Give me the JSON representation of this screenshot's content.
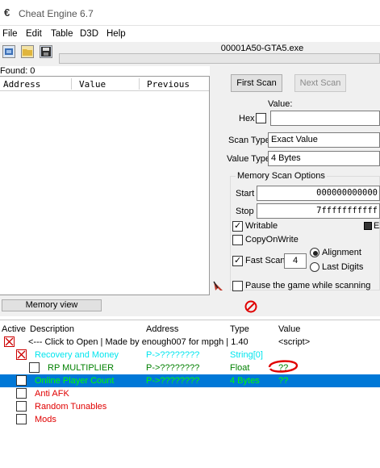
{
  "window": {
    "title": "Cheat Engine 6.7"
  },
  "menu": [
    "File",
    "Edit",
    "Table",
    "D3D",
    "Help"
  ],
  "process": "00001A50-GTA5.exe",
  "found": "Found: 0",
  "results_columns": [
    "Address",
    "Value",
    "Previous"
  ],
  "scan": {
    "first_scan": "First Scan",
    "next_scan": "Next Scan",
    "value_label": "Value:",
    "hex_label": "Hex",
    "scan_type_label": "Scan Type",
    "scan_type_value": "Exact Value",
    "value_type_label": "Value Type",
    "value_type_value": "4 Bytes",
    "memory_options_title": "Memory Scan Options",
    "start_label": "Start",
    "start_value": "000000000000",
    "stop_label": "Stop",
    "stop_value": "7fffffffffff",
    "writable_label": "Writable",
    "exe_label": "Exe",
    "copyonwrite_label": "CopyOnWrite",
    "fastscan_label": "Fast Scan",
    "fastscan_value": "4",
    "alignment_label": "Alignment",
    "lastdigits_label": "Last Digits",
    "pause_label": "Pause the game while scanning"
  },
  "memory_view_button": "Memory view",
  "table_columns": {
    "active": "Active",
    "description": "Description",
    "address": "Address",
    "type": "Type",
    "value": "Value"
  },
  "rows": [
    {
      "description": "<--- Click to Open  | Made by enough007 for mpgh | 1.40",
      "address": "",
      "type": "",
      "value": "<script>",
      "color": "#000000",
      "checked": true,
      "red_check": true
    },
    {
      "description": "Recovery and Money",
      "address": "P->????????",
      "type": "String[0]",
      "value": "",
      "color": "#00e5ee",
      "checked": false
    },
    {
      "description": "RP MULTIPLIER",
      "address": "P->????????",
      "type": "Float",
      "value": "??",
      "color": "#008000",
      "checked": false
    },
    {
      "description": "Online Player Count",
      "address": "P->????????",
      "type": "4 Bytes",
      "value": "??",
      "color": "#00ff00",
      "checked": false,
      "selected": true
    },
    {
      "description": "Anti AFK",
      "address": "",
      "type": "",
      "value": "",
      "color": "#e00000",
      "checked": false
    },
    {
      "description": "Random Tunables",
      "address": "",
      "type": "",
      "value": "",
      "color": "#e00000",
      "checked": false
    },
    {
      "description": "Mods",
      "address": "",
      "type": "",
      "value": "",
      "color": "#e00000",
      "checked": false
    }
  ]
}
